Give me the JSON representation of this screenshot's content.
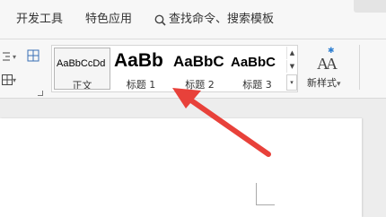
{
  "menu_tabs": {
    "dev_tools": "开发工具",
    "special_apps": "特色应用",
    "search": "查找命令、搜索模板"
  },
  "styles_gallery": {
    "items": [
      {
        "preview": "AaBbCcDd",
        "name": "正文"
      },
      {
        "preview": "AaBb",
        "name": "标题 1"
      },
      {
        "preview": "AaBbC",
        "name": "标题 2"
      },
      {
        "preview": "AaBbC",
        "name": "标题 3"
      }
    ]
  },
  "new_style": {
    "label": "新样式",
    "caret": "▾"
  },
  "colors": {
    "annotation_arrow": "#e8413a"
  }
}
